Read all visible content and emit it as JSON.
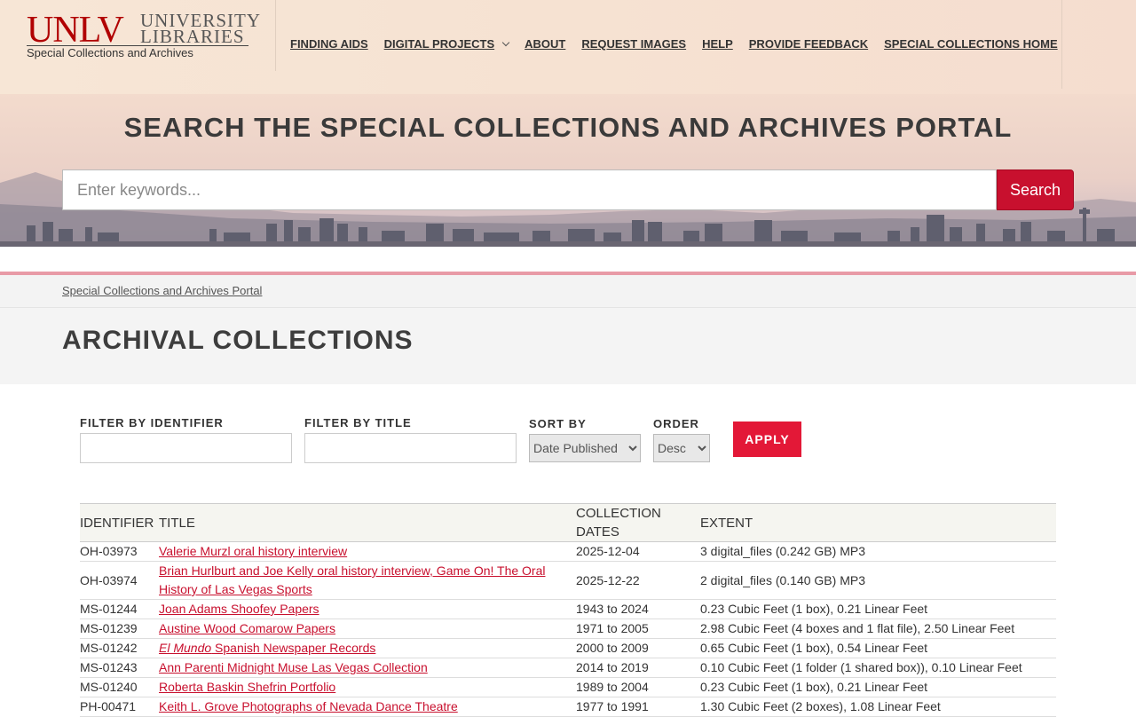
{
  "logo": {
    "wordmark": "UNLV",
    "line1": "UNIVERSITY",
    "line2": "LIBRARIES",
    "subtitle": "Special Collections and Archives"
  },
  "nav": [
    {
      "label": "FINDING AIDS"
    },
    {
      "label": "DIGITAL PROJECTS",
      "has_dropdown": true
    },
    {
      "label": "ABOUT"
    },
    {
      "label": "REQUEST IMAGES"
    },
    {
      "label": "HELP"
    },
    {
      "label": "PROVIDE FEEDBACK"
    },
    {
      "label": "SPECIAL COLLECTIONS HOME"
    }
  ],
  "hero": {
    "title": "SEARCH THE SPECIAL COLLECTIONS AND ARCHIVES PORTAL",
    "search_placeholder": "Enter keywords...",
    "search_button": "Search"
  },
  "breadcrumb": "Special Collections and Archives Portal",
  "page_title": "ARCHIVAL COLLECTIONS",
  "filters": {
    "identifier_label": "FILTER BY IDENTIFIER",
    "identifier_value": "",
    "title_label": "FILTER BY TITLE",
    "title_value": "",
    "sort_label": "SORT BY",
    "sort_value": "Date Published",
    "order_label": "ORDER",
    "order_value": "Desc",
    "apply_label": "APPLY"
  },
  "table": {
    "headers": {
      "identifier": "IDENTIFIER",
      "title": "TITLE",
      "dates_line1": "COLLECTION",
      "dates_line2": "DATES",
      "extent": "EXTENT"
    },
    "rows": [
      {
        "identifier": "OH-03973",
        "title": "Valerie Murzl oral history interview",
        "title_em": "",
        "dates": "2025-12-04",
        "extent": "3 digital_files (0.242 GB) MP3"
      },
      {
        "identifier": "OH-03974",
        "title": "Brian Hurlburt and Joe Kelly oral history interview, Game On! The Oral History of Las Vegas Sports",
        "title_em": "",
        "dates": "2025-12-22",
        "extent": "2 digital_files (0.140 GB) MP3"
      },
      {
        "identifier": "MS-01244",
        "title": "Joan Adams Shoofey Papers",
        "title_em": "",
        "dates": "1943 to 2024",
        "extent": "0.23 Cubic Feet (1 box), 0.21 Linear Feet"
      },
      {
        "identifier": "MS-01239",
        "title": "Austine Wood Comarow Papers",
        "title_em": "",
        "dates": "1971 to 2005",
        "extent": "2.98 Cubic Feet (4 boxes and 1 flat file), 2.50 Linear Feet"
      },
      {
        "identifier": "MS-01242",
        "title": " Spanish Newspaper Records",
        "title_em": "El Mundo",
        "dates": "2000 to 2009",
        "extent": "0.65 Cubic Feet (1 box), 0.54 Linear Feet"
      },
      {
        "identifier": "MS-01243",
        "title": "Ann Parenti Midnight Muse Las Vegas Collection",
        "title_em": "",
        "dates": "2014 to 2019",
        "extent": "0.10 Cubic Feet (1 folder (1 shared box)), 0.10 Linear Feet"
      },
      {
        "identifier": "MS-01240",
        "title": "Roberta Baskin Shefrin Portfolio",
        "title_em": "",
        "dates": "1989 to 2004",
        "extent": "0.23 Cubic Feet (1 box), 0.21 Linear Feet"
      },
      {
        "identifier": "PH-00471",
        "title": "Keith L. Grove Photographs of Nevada Dance Theatre",
        "title_em": "",
        "dates": "1977 to 1991",
        "extent": "1.30 Cubic Feet (2 boxes), 1.08 Linear Feet"
      }
    ]
  },
  "colors": {
    "brand_red": "#c8102e",
    "apply_red": "#e31837",
    "accent_pink": "#e89aa6"
  }
}
